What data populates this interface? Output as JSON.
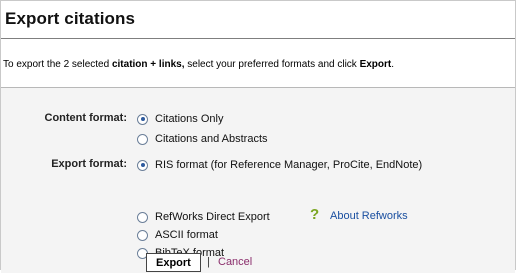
{
  "dialog": {
    "title": "Export citations",
    "instructions": {
      "prefix": "To export the 2 selected ",
      "bold_items": "citation + links,",
      "middle": " select your preferred formats and click ",
      "bold_action": "Export",
      "suffix": "."
    }
  },
  "content_format": {
    "label": "Content format:",
    "options": [
      {
        "label": "Citations Only",
        "checked": true
      },
      {
        "label": "Citations and Abstracts",
        "checked": false
      }
    ]
  },
  "export_format": {
    "label": "Export format:",
    "options": [
      {
        "label": "RIS format (for Reference Manager, ProCite, EndNote)",
        "checked": true
      },
      {
        "label": "RefWorks Direct Export",
        "checked": false
      },
      {
        "label": "ASCII format",
        "checked": false
      },
      {
        "label": "BibTeX format",
        "checked": false
      }
    ],
    "help_icon": "?",
    "about_link": "About Refworks"
  },
  "actions": {
    "export_label": "Export",
    "separator": "|",
    "cancel_label": "Cancel"
  },
  "colors": {
    "accent_radio": "#2d5a9e",
    "help_icon": "#7aa521",
    "link": "#1a4fa0",
    "cancel_link": "#8a2d6b",
    "panel_bg": "#f4f4f4"
  }
}
